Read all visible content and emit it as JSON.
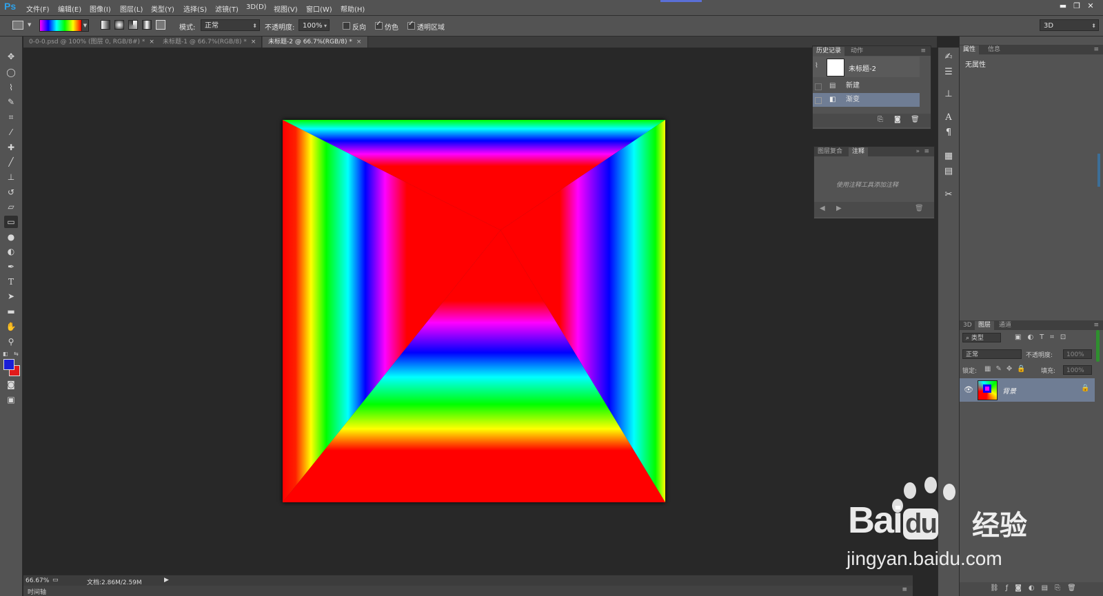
{
  "app": {
    "logo": "Ps"
  },
  "menubar": {
    "items": [
      "文件(F)",
      "编辑(E)",
      "图像(I)",
      "图层(L)",
      "类型(Y)",
      "选择(S)",
      "滤镜(T)",
      "3D(D)",
      "视图(V)",
      "窗口(W)",
      "帮助(H)"
    ]
  },
  "options": {
    "mode_label": "模式:",
    "mode_value": "正常",
    "opacity_label": "不透明度:",
    "opacity_value": "100%",
    "reverse_label": "反向",
    "reverse_checked": false,
    "dither_label": "仿色",
    "dither_checked": true,
    "transparency_label": "透明区域",
    "transparency_checked": true,
    "workspace_value": "3D"
  },
  "tabs": [
    {
      "label": "0-0-0.psd @ 100% (图层 0, RGB/8#) *",
      "close": "×",
      "active": false
    },
    {
      "label": "未标题-1 @ 66.7%(RGB/8) *",
      "close": "×",
      "active": false
    },
    {
      "label": "未标题-2 @ 66.7%(RGB/8) *",
      "close": "×",
      "active": true
    }
  ],
  "status": {
    "zoom": "66.67%",
    "doc_info": "文档:2.86M/2.59M",
    "timeline_label": "时间轴"
  },
  "history_panel": {
    "tabs": [
      "历史记录",
      "动作"
    ],
    "snapshot_name": "未标题-2",
    "items": [
      {
        "label": "新建",
        "selected": false
      },
      {
        "label": "渐变",
        "selected": true
      }
    ]
  },
  "notes_panel": {
    "tabs": [
      "图层复合",
      "注释"
    ],
    "hint": "使用注释工具添加注释"
  },
  "properties_panel": {
    "tabs": [
      "属性",
      "信息"
    ],
    "content": "无属性"
  },
  "layers_panel": {
    "tabs": [
      "3D",
      "图层",
      "通道"
    ],
    "filter_kind": "类型",
    "blend_mode": "正常",
    "opacity_label": "不透明度:",
    "opacity_value": "100%",
    "lock_label": "锁定:",
    "fill_label": "填充:",
    "fill_value": "100%",
    "layers": [
      {
        "name": "背景",
        "visible": true,
        "locked": true
      }
    ]
  },
  "watermark": {
    "brand": "Bai",
    "brand_suffix": "du",
    "product": "经验",
    "url": "jingyan.baidu.com"
  },
  "colors": {
    "foreground": "#1a1fd6",
    "background": "#e21a1a",
    "selection": "#6f7d94",
    "logo": "#2fa1e8"
  }
}
